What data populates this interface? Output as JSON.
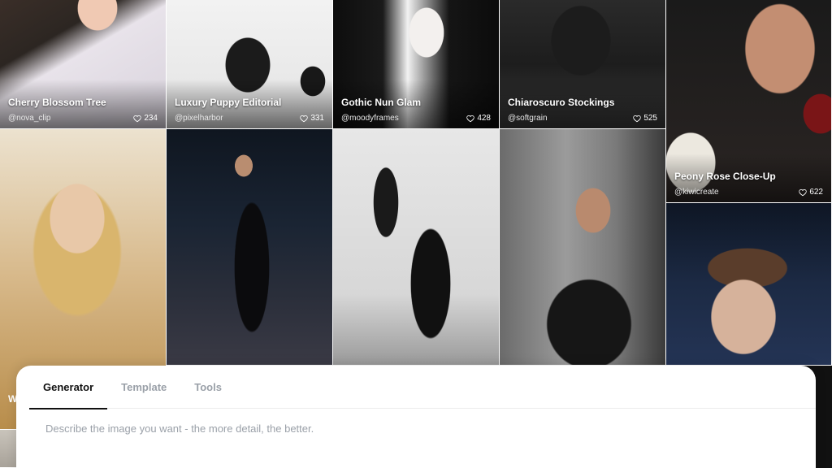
{
  "gallery": {
    "tiles": [
      {
        "title": "Cherry Blossom Tree",
        "author": "@nova_clip",
        "likes": "234"
      },
      {
        "title": "Luxury Puppy Editorial",
        "author": "@pixelharbor",
        "likes": "331"
      },
      {
        "title": "Gothic Nun Glam",
        "author": "@moodyframes",
        "likes": "428"
      },
      {
        "title": "Chiaroscuro Stockings",
        "author": "@softgrain",
        "likes": "525"
      },
      {
        "title": "Peony Rose Close-Up",
        "author": "@kiwicreate",
        "likes": "622"
      }
    ],
    "partial_title": "W"
  },
  "panel": {
    "tabs": [
      {
        "label": "Generator",
        "active": true
      },
      {
        "label": "Template",
        "active": false
      },
      {
        "label": "Tools",
        "active": false
      }
    ],
    "prompt_placeholder": "Describe the image you want - the more detail, the better."
  },
  "colors": {
    "active_tab": "#111111",
    "inactive_tab": "#9aa0a8"
  }
}
